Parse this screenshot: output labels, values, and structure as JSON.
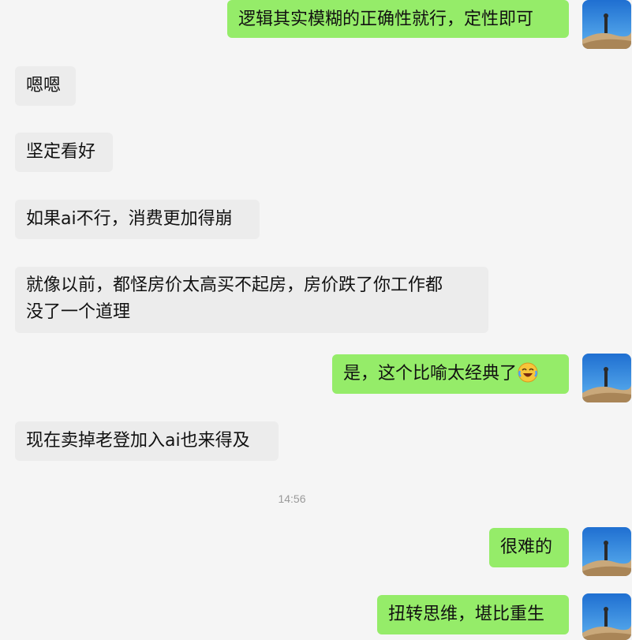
{
  "messages": [
    {
      "side": "out",
      "text": "逻辑其实模糊的正确性就行，定性即可"
    },
    {
      "side": "in",
      "text": "嗯嗯"
    },
    {
      "side": "in",
      "text": "坚定看好"
    },
    {
      "side": "in",
      "text": "如果ai不行，消费更加得崩"
    },
    {
      "side": "in",
      "line1": "就像以前，都怪房价太高买不起房，房价跌了你工作都",
      "line2": "没了一个道理"
    },
    {
      "side": "out",
      "text": "是，这个比喻太经典了",
      "emoji": "laughing-crying-emoji"
    },
    {
      "side": "in",
      "text": "现在卖掉老登加入ai也来得及"
    },
    {
      "side": "out",
      "text": "很难的"
    },
    {
      "side": "out",
      "text": "扭转思维，堪比重生"
    }
  ],
  "timestamp": "14:56",
  "colors": {
    "background": "#f5f5f5",
    "incoming_bubble": "#ececec",
    "outgoing_bubble": "#95ec69",
    "timestamp_text": "#9a9a9a"
  }
}
